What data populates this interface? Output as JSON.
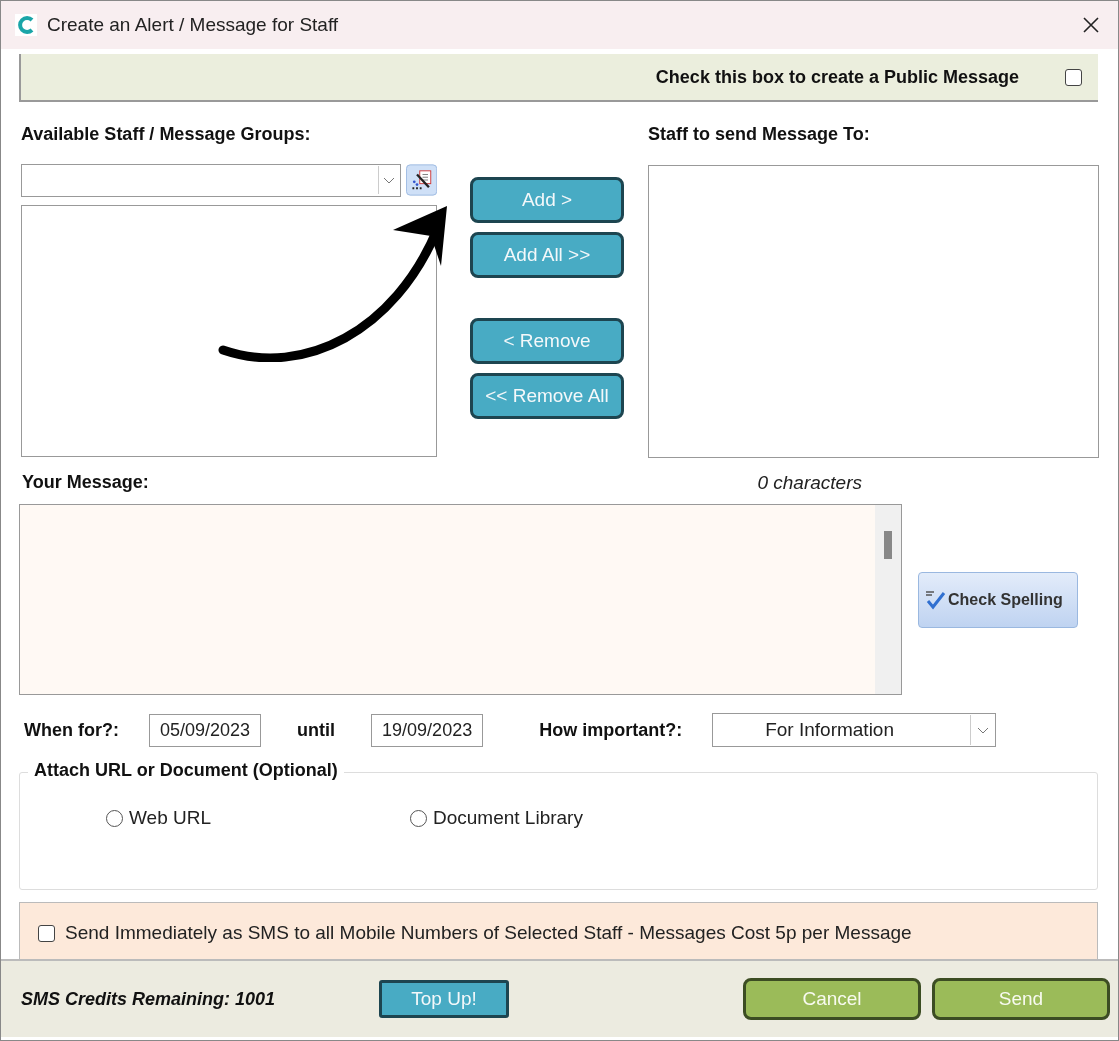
{
  "window": {
    "title": "Create an Alert / Message for Staff"
  },
  "public_message": {
    "label": "Check this box to create a Public Message",
    "checked": false
  },
  "available": {
    "label": "Available Staff / Message Groups:"
  },
  "transfer_buttons": [
    {
      "label": "Add >",
      "kind": "add"
    },
    {
      "label": "Add All >>",
      "kind": "add"
    },
    {
      "label": "< Remove",
      "kind": "remove"
    },
    {
      "label": "<< Remove All",
      "kind": "remove"
    }
  ],
  "recipients": {
    "label": "Staff to send Message To:"
  },
  "message": {
    "label": "Your Message:",
    "counter": "0 characters"
  },
  "check_spelling": {
    "label": "Check Spelling"
  },
  "when": {
    "label": "When for?:",
    "from": "05/09/2023",
    "until_label": "until",
    "until": "19/09/2023"
  },
  "importance": {
    "label": "How important?:",
    "value": "For Information"
  },
  "attach": {
    "title": "Attach URL or Document (Optional)",
    "options": [
      {
        "label": "Web URL",
        "selected": false
      },
      {
        "label": "Document Library",
        "selected": false
      }
    ]
  },
  "sms": {
    "label": "Send Immediately as SMS to all Mobile Numbers of Selected Staff - Messages Cost 5p per Message",
    "checked": false
  },
  "footer": {
    "credits": "SMS Credits Remaining: 1001",
    "top_up": "Top Up!",
    "buttons": [
      "Cancel",
      "Send"
    ]
  }
}
